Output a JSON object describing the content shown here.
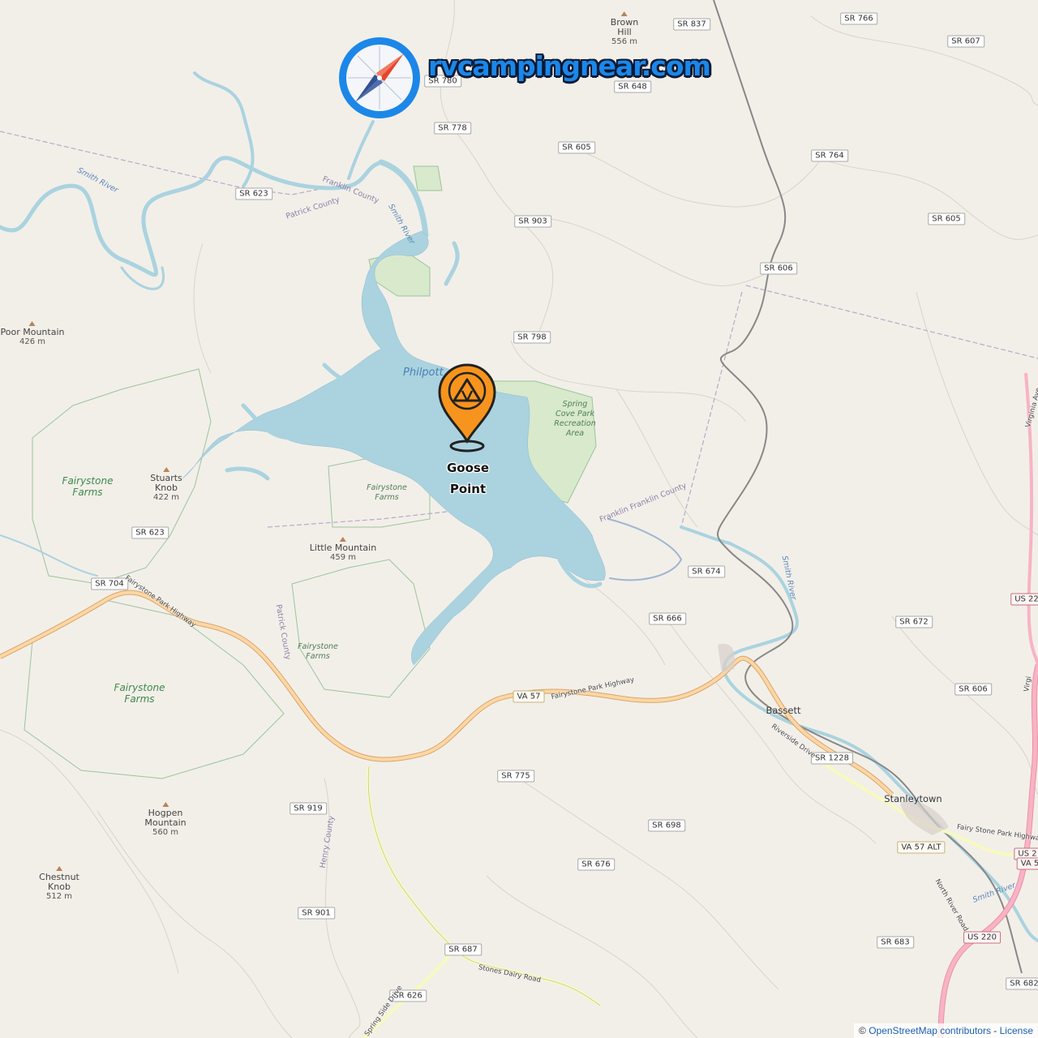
{
  "brand": {
    "site_name": "rvcampingnear.com",
    "logo_icon": "compass-icon",
    "accent_color": "#1c87e8"
  },
  "marker": {
    "icon": "campground-tent-pin-icon",
    "label": "Goose\nPoint",
    "color": "#f7941d"
  },
  "map": {
    "lake_label": "Philpott",
    "colors": {
      "water": "#aad3df",
      "park": "#c8facc",
      "land": "#f2efe9",
      "primary_road": "#fcd6a4",
      "secondary_road": "#f7fabf",
      "trunk_road": "#f9b2c6"
    }
  },
  "road_shields": [
    {
      "text": "SR 837",
      "type": "secondary"
    },
    {
      "text": "SR 766",
      "type": "secondary"
    },
    {
      "text": "SR 607",
      "type": "secondary"
    },
    {
      "text": "SR 780",
      "type": "secondary"
    },
    {
      "text": "SR 648",
      "type": "secondary"
    },
    {
      "text": "SR 778",
      "type": "secondary"
    },
    {
      "text": "SR 605",
      "type": "secondary"
    },
    {
      "text": "SR 764",
      "type": "secondary"
    },
    {
      "text": "SR 623",
      "type": "secondary"
    },
    {
      "text": "SR 903",
      "type": "secondary"
    },
    {
      "text": "SR 605",
      "type": "secondary"
    },
    {
      "text": "SR 606",
      "type": "secondary"
    },
    {
      "text": "SR 798",
      "type": "secondary"
    },
    {
      "text": "SR 623",
      "type": "secondary"
    },
    {
      "text": "SR 704",
      "type": "secondary"
    },
    {
      "text": "SR 674",
      "type": "secondary"
    },
    {
      "text": "SR 666",
      "type": "secondary"
    },
    {
      "text": "SR 672",
      "type": "secondary"
    },
    {
      "text": "US 22",
      "type": "trunk"
    },
    {
      "text": "SR 606",
      "type": "secondary"
    },
    {
      "text": "VA 57",
      "type": "primary"
    },
    {
      "text": "SR 1228",
      "type": "secondary"
    },
    {
      "text": "SR 775",
      "type": "secondary"
    },
    {
      "text": "SR 919",
      "type": "secondary"
    },
    {
      "text": "SR 698",
      "type": "secondary"
    },
    {
      "text": "VA 57 ALT",
      "type": "primary"
    },
    {
      "text": "US 2",
      "type": "trunk"
    },
    {
      "text": "VA 5",
      "type": "trunk"
    },
    {
      "text": "SR 676",
      "type": "secondary"
    },
    {
      "text": "SR 901",
      "type": "secondary"
    },
    {
      "text": "SR 687",
      "type": "secondary"
    },
    {
      "text": "SR 683",
      "type": "secondary"
    },
    {
      "text": "US 220",
      "type": "trunk"
    },
    {
      "text": "SR 626",
      "type": "secondary"
    },
    {
      "text": "SR 682",
      "type": "secondary"
    }
  ],
  "peaks": [
    {
      "name": "Brown\nHill",
      "elevation": "556 m"
    },
    {
      "name": "Poor Mountain",
      "elevation": "426 m"
    },
    {
      "name": "Stuarts\nKnob",
      "elevation": "422 m"
    },
    {
      "name": "Little Mountain",
      "elevation": "459 m"
    },
    {
      "name": "Hogpen\nMountain",
      "elevation": "560 m"
    },
    {
      "name": "Chestnut\nKnob",
      "elevation": "512 m"
    }
  ],
  "parks": [
    {
      "name": "Fairystone\nFarms"
    },
    {
      "name": "Fairystone\nFarms"
    },
    {
      "name": "Fairystone\nFarms"
    },
    {
      "name": "Fairystone\nFarms"
    },
    {
      "name": "Spring\nCove Park\nRecreation\nArea"
    }
  ],
  "towns": [
    "Bassett",
    "Stanleytown"
  ],
  "waterways": [
    "Smith River",
    "Smith River",
    "Smith River",
    "Smith River"
  ],
  "admin_labels": [
    "Franklin County",
    "Patrick County",
    "Franklin Franklin County",
    "Patrick County",
    "Henry County"
  ],
  "road_names": [
    "Fairystone Park Highway",
    "Fairystone Park Highway",
    "Riverside Drive",
    "Fairy Stone Park Highway",
    "North River Road",
    "Stones Dairy Road",
    "Spring Side Drive",
    "Virginia Ave",
    "Virgi"
  ],
  "attribution": {
    "prefix": "©",
    "osm": "OpenStreetMap contributors",
    "separator": " - ",
    "license": "License"
  }
}
